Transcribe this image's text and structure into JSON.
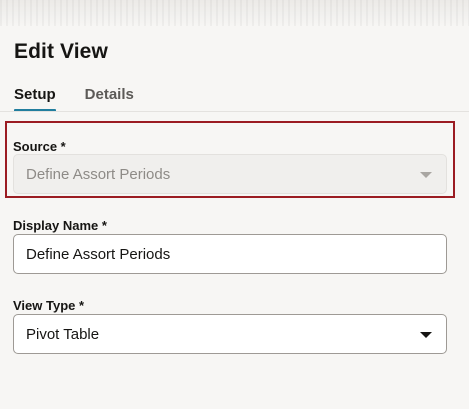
{
  "header": {
    "title": "Edit View"
  },
  "tabs": [
    {
      "label": "Setup",
      "active": true
    },
    {
      "label": "Details",
      "active": false
    }
  ],
  "form": {
    "source": {
      "label": "Source *",
      "value": "Define Assort Periods",
      "disabled": true,
      "icon": "chevron-down-icon"
    },
    "display_name": {
      "label": "Display Name *",
      "value": "Define Assort Periods"
    },
    "view_type": {
      "label": "View Type *",
      "value": "Pivot Table",
      "icon": "chevron-down-icon"
    }
  },
  "colors": {
    "accent_tab_underline": "#227e9e",
    "highlight_border": "#9b1c22"
  }
}
